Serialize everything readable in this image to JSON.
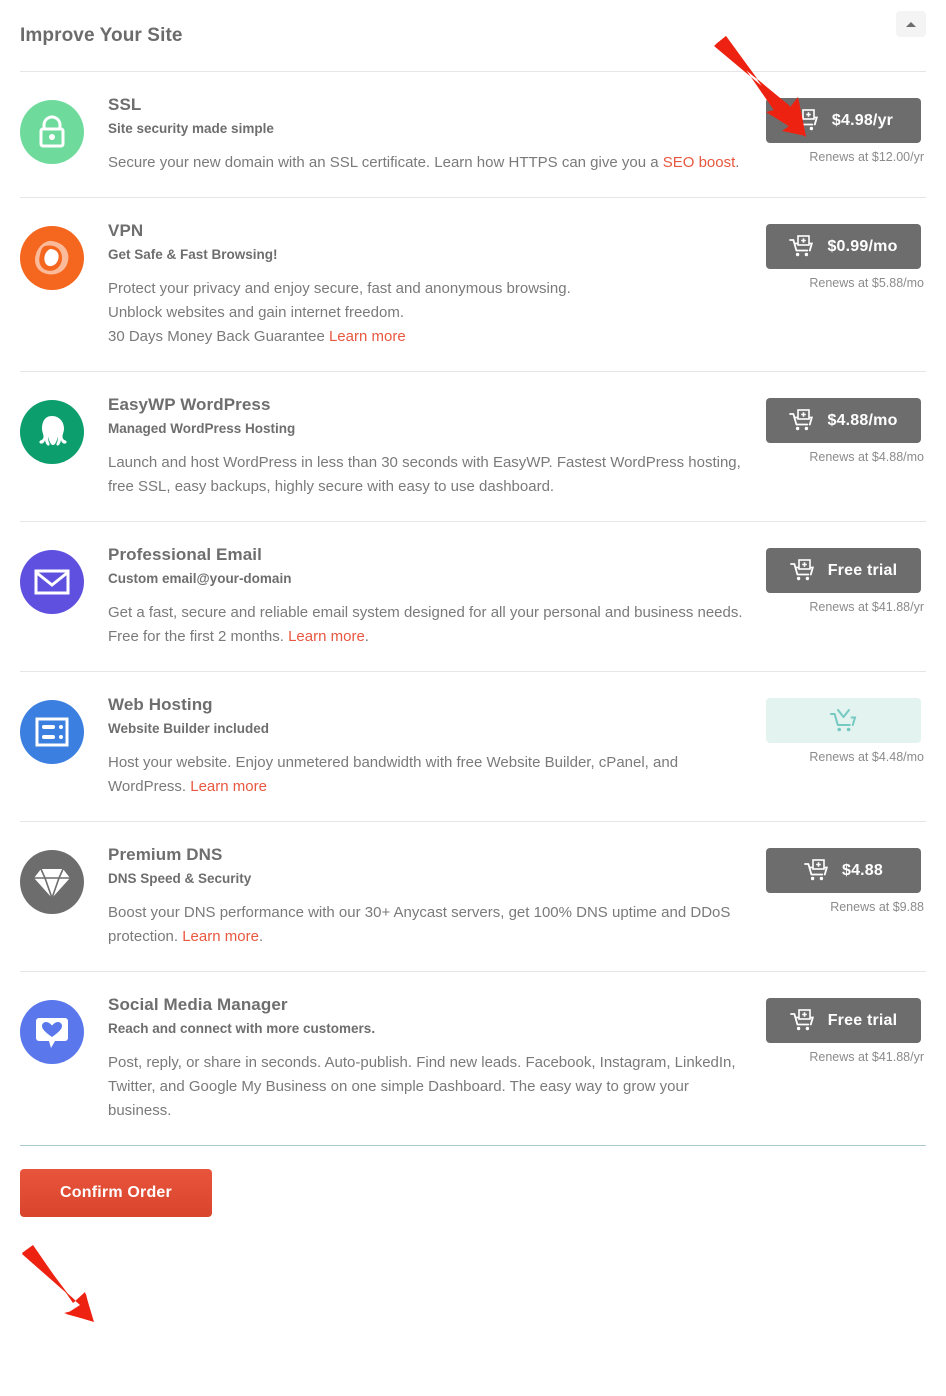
{
  "header": {
    "title": "Improve Your Site",
    "collapse_icon": "caret-up-icon"
  },
  "products": [
    {
      "id": "ssl",
      "icon": "lock-icon",
      "icon_bg": "#6edb9d",
      "title": "SSL",
      "subtitle": "Site security made simple",
      "desc_before_link": "Secure your new domain with an SSL certificate. Learn how HTTPS can give you a ",
      "link_text": "SEO boost",
      "desc_after_link": ".",
      "cta_label": "$4.98/yr",
      "cta_state": "add",
      "cart_icon": "cart-plus-icon",
      "renews": "Renews at $12.00/yr"
    },
    {
      "id": "vpn",
      "icon": "vpn-swirl-icon",
      "icon_bg": "#f5661e",
      "title": "VPN",
      "subtitle": "Get Safe & Fast Browsing!",
      "desc_before_link": "Protect your privacy and enjoy secure, fast and anonymous browsing.\nUnblock websites and gain internet freedom.\n30 Days Money Back Guarantee ",
      "link_text": "Learn more",
      "desc_after_link": "",
      "cta_label": "$0.99/mo",
      "cta_state": "add",
      "cart_icon": "cart-plus-icon",
      "renews": "Renews at $5.88/mo"
    },
    {
      "id": "easywp-wordpress",
      "icon": "octopus-icon",
      "icon_bg": "#0c9e6c",
      "title": "EasyWP WordPress",
      "subtitle": "Managed WordPress Hosting",
      "desc_before_link": "Launch and host WordPress in less than 30 seconds with EasyWP. Fastest WordPress hosting, free SSL, easy backups, highly secure with easy to use dashboard.",
      "link_text": "",
      "desc_after_link": "",
      "cta_label": "$4.88/mo",
      "cta_state": "add",
      "cart_icon": "cart-plus-icon",
      "renews": "Renews at $4.88/mo"
    },
    {
      "id": "professional-email",
      "icon": "envelope-icon",
      "icon_bg": "#6050e0",
      "title": "Professional Email",
      "subtitle": "Custom email@your-domain",
      "desc_before_link": "Get a fast, secure and reliable email system designed for all your personal and business needs.\nFree for the first 2 months. ",
      "link_text": "Learn more",
      "desc_after_link": ".",
      "cta_label": "Free trial",
      "cta_state": "add",
      "cart_icon": "cart-plus-icon",
      "renews": "Renews at $41.88/yr"
    },
    {
      "id": "web-hosting",
      "icon": "server-panel-icon",
      "icon_bg": "#3b7fe0",
      "title": "Web Hosting",
      "subtitle": "Website Builder included",
      "desc_before_link": "Host your website. Enjoy unmetered bandwidth with free Website Builder, cPanel, and WordPress. ",
      "link_text": "Learn more",
      "desc_after_link": "",
      "cta_label": "",
      "cta_state": "added",
      "cart_icon": "cart-check-icon",
      "renews": "Renews at $4.48/mo"
    },
    {
      "id": "premium-dns",
      "icon": "diamond-icon",
      "icon_bg": "#6d6d6d",
      "title": "Premium DNS",
      "subtitle": "DNS Speed & Security",
      "desc_before_link": "Boost your DNS performance with our 30+ Anycast servers, get 100% DNS uptime and DDoS protection. ",
      "link_text": "Learn more",
      "desc_after_link": ".",
      "cta_label": "$4.88",
      "cta_state": "add",
      "cart_icon": "cart-plus-icon",
      "renews": "Renews at $9.88"
    },
    {
      "id": "social-media-manager",
      "icon": "heart-bubble-icon",
      "icon_bg": "#5a78ec",
      "title": "Social Media Manager",
      "subtitle": "Reach and connect with more customers.",
      "desc_before_link": "Post, reply, or share in seconds. Auto-publish. Find new leads. Facebook, Instagram, LinkedIn, Twitter, and Google My Business on one simple Dashboard. The easy way to grow your business.",
      "link_text": "",
      "desc_after_link": "",
      "cta_label": "Free trial",
      "cta_state": "add",
      "cart_icon": "cart-plus-icon",
      "renews": "Renews at $41.88/yr"
    }
  ],
  "footer": {
    "confirm_label": "Confirm Order"
  },
  "annotations": {
    "arrow_color": "#ee2211",
    "arrow_top_target": "ssl-add-to-cart-button",
    "arrow_bottom_target": "confirm-order-button"
  },
  "colors": {
    "link": "#e8573f",
    "cta_bg": "#6d6d6d",
    "cta_added_bg": "#e2f3f0",
    "confirm_bg": "#e0492f"
  }
}
